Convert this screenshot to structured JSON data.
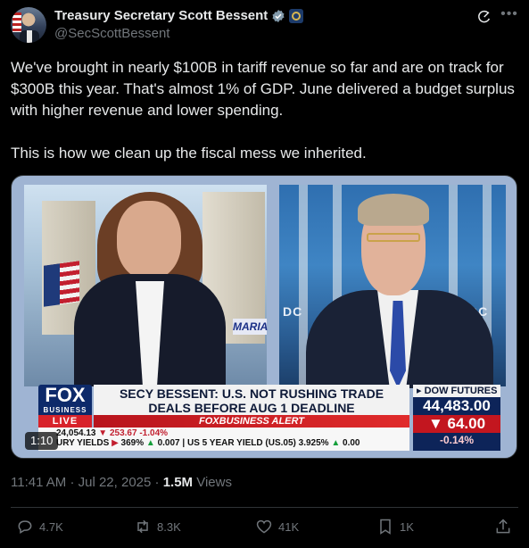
{
  "author": {
    "name": "Treasury Secretary Scott Bessent",
    "handle": "@SecScottBessent"
  },
  "tweet": {
    "paragraphs": [
      "We've brought in nearly $100B in tariff revenue so far and are on track for $300B this year. That's almost 1% of GDP. June delivered a budget surplus with higher revenue and lower spending.",
      "This is how we clean up the fiscal mess we inherited."
    ]
  },
  "media": {
    "duration": "1:10",
    "headline_line1": "SECY BESSENT: U.S. NOT RUSHING TRADE",
    "headline_line2": "DEALS BEFORE AUG 1 DEADLINE",
    "logo_main": "FOX",
    "logo_sub": "BUSINESS",
    "live": "LIVE",
    "alert": "FOXBUSINESS ALERT",
    "left_sign": "MARIA",
    "dc_left": "DC",
    "dc_right": "DC",
    "ticker_row1_a": "24,054.13",
    "ticker_row1_b": "253.67",
    "ticker_row1_c": "-1.04%",
    "ticker_row2_a": "URY YIELDS",
    "ticker_row2_b": "369%",
    "ticker_row2_c": "0.007",
    "ticker_row2_d": "US 5 YEAR YIELD (US.05)",
    "ticker_row2_e": "3.925%",
    "ticker_row2_f": "0.00",
    "futures_label": "DOW FUTURES",
    "futures_value": "44,483.00",
    "futures_change": "64.00",
    "futures_pct": "-0.14%"
  },
  "meta": {
    "time": "11:41 AM",
    "separator": "·",
    "date": "Jul 22, 2025",
    "views_count": "1.5M",
    "views_label": "Views"
  },
  "actions": {
    "replies": "4.7K",
    "reposts": "8.3K",
    "likes": "41K",
    "bookmarks": "1K"
  }
}
